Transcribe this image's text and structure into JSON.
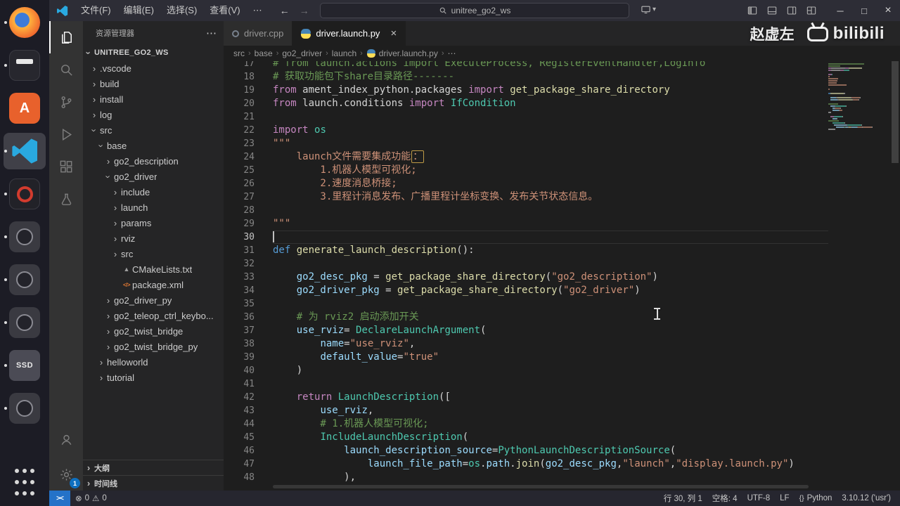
{
  "colors": {
    "editor_bg": "#1e1e1e",
    "sidebar_bg": "#252526",
    "activitybar_bg": "#333333",
    "titlebar_bg": "#2d2d36",
    "statusbar_bg": "#26262f",
    "remote_blue": "#2472c8",
    "badge_blue": "#0e70c0",
    "dock_bg": "#1c1c25"
  },
  "token_colors": {
    "c": "#6a9955",
    "k": "#c586c0",
    "kd": "#569cd6",
    "f": "#dcdcaa",
    "s": "#ce9178",
    "sbox": "#ce9178",
    "v": "#9cdcfe",
    "t": "#4ec9b0",
    "p": "#bdbdbd"
  },
  "icons": {
    "chevron": "›",
    "more": "⋯",
    "back": "←",
    "forward": "→",
    "cast_chevron": "▾",
    "window_minimize": "─",
    "window_maximize": "□",
    "window_close": "×",
    "error": "⊗",
    "warning": "⚠",
    "braces": "{}",
    "remote": "><",
    "close": "×"
  },
  "titlebar": {
    "menus": [
      {
        "id": "file",
        "label": "文件(F)"
      },
      {
        "id": "edit",
        "label": "编辑(E)"
      },
      {
        "id": "selection",
        "label": "选择(S)"
      },
      {
        "id": "view",
        "label": "查看(V)"
      },
      {
        "id": "more",
        "label": "⋯"
      }
    ],
    "search_placeholder": "unitree_go2_ws"
  },
  "watermark": {
    "author": "赵虚左",
    "brand": "bilibili"
  },
  "activitybar": {
    "badge": "1"
  },
  "dock": {
    "items": [
      {
        "name": "firefox",
        "kind": "firefox",
        "running": true
      },
      {
        "name": "files-app",
        "kind": "darkapp",
        "running": true
      },
      {
        "name": "app-store",
        "kind": "store",
        "label": "A",
        "running": false
      },
      {
        "name": "vscode",
        "kind": "vscode",
        "running": true,
        "active": true
      },
      {
        "name": "screen-recorder",
        "kind": "recorder",
        "running": true
      },
      {
        "name": "camera-1",
        "kind": "cam",
        "running": true
      },
      {
        "name": "camera-2",
        "kind": "cam",
        "running": true
      },
      {
        "name": "camera-3",
        "kind": "cam",
        "running": true
      },
      {
        "name": "ssd-drive",
        "kind": "ssd",
        "label": "SSD",
        "running": true
      },
      {
        "name": "camera-4",
        "kind": "cam",
        "running": true
      },
      {
        "name": "show-apps",
        "kind": "grid",
        "running": false
      }
    ]
  },
  "sidebar": {
    "title": "资源管理器",
    "section_label": "UNITREE_GO2_WS",
    "tree": [
      {
        "label": ".vscode",
        "indent": 0,
        "chevron": "right"
      },
      {
        "label": "build",
        "indent": 0,
        "chevron": "right"
      },
      {
        "label": "install",
        "indent": 0,
        "chevron": "right"
      },
      {
        "label": "log",
        "indent": 0,
        "chevron": "right"
      },
      {
        "label": "src",
        "indent": 0,
        "chevron": "down"
      },
      {
        "label": "base",
        "indent": 1,
        "chevron": "down"
      },
      {
        "label": "go2_description",
        "indent": 2,
        "chevron": "right"
      },
      {
        "label": "go2_driver",
        "indent": 2,
        "chevron": "down"
      },
      {
        "label": "include",
        "indent": 3,
        "chevron": "right"
      },
      {
        "label": "launch",
        "indent": 3,
        "chevron": "right"
      },
      {
        "label": "params",
        "indent": 3,
        "chevron": "right"
      },
      {
        "label": "rviz",
        "indent": 3,
        "chevron": "right"
      },
      {
        "label": "src",
        "indent": 3,
        "chevron": "right"
      },
      {
        "label": "CMakeLists.txt",
        "indent": 3,
        "icon": "cmake"
      },
      {
        "label": "package.xml",
        "indent": 3,
        "icon": "xml"
      },
      {
        "label": "go2_driver_py",
        "indent": 2,
        "chevron": "right"
      },
      {
        "label": "go2_teleop_ctrl_keybo...",
        "indent": 2,
        "chevron": "right"
      },
      {
        "label": "go2_twist_bridge",
        "indent": 2,
        "chevron": "right"
      },
      {
        "label": "go2_twist_bridge_py",
        "indent": 2,
        "chevron": "right"
      },
      {
        "label": "helloworld",
        "indent": 1,
        "chevron": "right"
      },
      {
        "label": "tutorial",
        "indent": 1,
        "chevron": "right"
      }
    ],
    "bottom_sections": [
      {
        "id": "outline",
        "label": "大纲"
      },
      {
        "id": "timeline",
        "label": "时间线"
      }
    ]
  },
  "tabs": [
    {
      "id": "driver-cpp",
      "label": "driver.cpp",
      "icon": "cpp",
      "active": false
    },
    {
      "id": "driver-launch-py",
      "label": "driver.launch.py",
      "icon": "python",
      "active": true,
      "close": "×"
    }
  ],
  "breadcrumbs": [
    {
      "id": "src",
      "label": "src"
    },
    {
      "id": "base",
      "label": "base"
    },
    {
      "id": "go2_driver",
      "label": "go2_driver"
    },
    {
      "id": "launch",
      "label": "launch"
    },
    {
      "id": "driver-launch-py",
      "label": "driver.launch.py",
      "icon": "python"
    },
    {
      "id": "symbol-more",
      "label": "⋯"
    }
  ],
  "editor": {
    "lines": [
      {
        "n": 17,
        "seg": [
          [
            "c",
            "# from launch.actions import ExecuteProcess, RegisterEventHandler,LogInfo"
          ]
        ]
      },
      {
        "n": 18,
        "seg": [
          [
            "c",
            "# 获取功能包下share目录路径-------"
          ]
        ]
      },
      {
        "n": 19,
        "seg": [
          [
            "k",
            "from "
          ],
          [
            "p",
            "ament_index_python.packages "
          ],
          [
            "k",
            "import "
          ],
          [
            "f",
            "get_package_share_directory"
          ]
        ]
      },
      {
        "n": 20,
        "seg": [
          [
            "k",
            "from "
          ],
          [
            "p",
            "launch.conditions "
          ],
          [
            "k",
            "import "
          ],
          [
            "t",
            "IfCondition"
          ]
        ]
      },
      {
        "n": 21,
        "seg": []
      },
      {
        "n": 22,
        "seg": [
          [
            "k",
            "import "
          ],
          [
            "t",
            "os"
          ]
        ]
      },
      {
        "n": 23,
        "seg": [
          [
            "s",
            "\"\"\""
          ]
        ]
      },
      {
        "n": 24,
        "seg": [
          [
            "s",
            "    launch文件需要集成功能"
          ],
          [
            "sbox",
            "："
          ]
        ]
      },
      {
        "n": 25,
        "seg": [
          [
            "s",
            "        1.机器人模型可视化;"
          ]
        ]
      },
      {
        "n": 26,
        "seg": [
          [
            "s",
            "        2.速度消息桥接;"
          ]
        ]
      },
      {
        "n": 27,
        "seg": [
          [
            "s",
            "        3.里程计消息发布、广播里程计坐标变换、发布关节状态信息。"
          ]
        ]
      },
      {
        "n": 28,
        "seg": []
      },
      {
        "n": 29,
        "seg": [
          [
            "s",
            "\"\"\""
          ]
        ]
      },
      {
        "n": 30,
        "seg": [],
        "cur": true,
        "cursor": true
      },
      {
        "n": 31,
        "seg": [
          [
            "kd",
            "def "
          ],
          [
            "f",
            "generate_launch_description"
          ],
          [
            "p",
            "():"
          ]
        ]
      },
      {
        "n": 32,
        "seg": []
      },
      {
        "n": 33,
        "seg": [
          [
            "p",
            "    "
          ],
          [
            "v",
            "go2_desc_pkg"
          ],
          [
            "p",
            " = "
          ],
          [
            "f",
            "get_package_share_directory"
          ],
          [
            "p",
            "("
          ],
          [
            "s",
            "\"go2_description\""
          ],
          [
            "p",
            ")"
          ]
        ]
      },
      {
        "n": 34,
        "seg": [
          [
            "p",
            "    "
          ],
          [
            "v",
            "go2_driver_pkg"
          ],
          [
            "p",
            " = "
          ],
          [
            "f",
            "get_package_share_directory"
          ],
          [
            "p",
            "("
          ],
          [
            "s",
            "\"go2_driver\""
          ],
          [
            "p",
            ")"
          ]
        ]
      },
      {
        "n": 35,
        "seg": []
      },
      {
        "n": 36,
        "seg": [
          [
            "c",
            "    # 为 rviz2 启动添加开关"
          ]
        ]
      },
      {
        "n": 37,
        "seg": [
          [
            "p",
            "    "
          ],
          [
            "v",
            "use_rviz"
          ],
          [
            "p",
            "= "
          ],
          [
            "t",
            "DeclareLaunchArgument"
          ],
          [
            "p",
            "("
          ]
        ]
      },
      {
        "n": 38,
        "seg": [
          [
            "p",
            "        "
          ],
          [
            "v",
            "name"
          ],
          [
            "p",
            "="
          ],
          [
            "s",
            "\"use_rviz\""
          ],
          [
            "p",
            ","
          ]
        ]
      },
      {
        "n": 39,
        "seg": [
          [
            "p",
            "        "
          ],
          [
            "v",
            "default_value"
          ],
          [
            "p",
            "="
          ],
          [
            "s",
            "\"true\""
          ]
        ]
      },
      {
        "n": 40,
        "seg": [
          [
            "p",
            "    )"
          ]
        ]
      },
      {
        "n": 41,
        "seg": []
      },
      {
        "n": 42,
        "seg": [
          [
            "p",
            "    "
          ],
          [
            "k",
            "return "
          ],
          [
            "t",
            "LaunchDescription"
          ],
          [
            "p",
            "(["
          ]
        ]
      },
      {
        "n": 43,
        "seg": [
          [
            "p",
            "        "
          ],
          [
            "v",
            "use_rviz"
          ],
          [
            "p",
            ","
          ]
        ]
      },
      {
        "n": 44,
        "seg": [
          [
            "c",
            "        # 1.机器人模型可视化;"
          ]
        ]
      },
      {
        "n": 45,
        "seg": [
          [
            "p",
            "        "
          ],
          [
            "t",
            "IncludeLaunchDescription"
          ],
          [
            "p",
            "("
          ]
        ]
      },
      {
        "n": 46,
        "seg": [
          [
            "p",
            "            "
          ],
          [
            "v",
            "launch_description_source"
          ],
          [
            "p",
            "="
          ],
          [
            "t",
            "PythonLaunchDescriptionSource"
          ],
          [
            "p",
            "("
          ]
        ]
      },
      {
        "n": 47,
        "seg": [
          [
            "p",
            "                "
          ],
          [
            "v",
            "launch_file_path"
          ],
          [
            "p",
            "="
          ],
          [
            "t",
            "os"
          ],
          [
            "p",
            "."
          ],
          [
            "v",
            "path"
          ],
          [
            "p",
            "."
          ],
          [
            "f",
            "join"
          ],
          [
            "p",
            "("
          ],
          [
            "v",
            "go2_desc_pkg"
          ],
          [
            "p",
            ","
          ],
          [
            "s",
            "\"launch\""
          ],
          [
            "p",
            ","
          ],
          [
            "s",
            "\"display.launch.py\""
          ],
          [
            "p",
            ")"
          ]
        ]
      },
      {
        "n": 48,
        "seg": [
          [
            "p",
            "            ),"
          ]
        ]
      }
    ]
  },
  "statusbar": {
    "problems": {
      "errors": "0",
      "warnings": "0"
    },
    "right": [
      {
        "name": "cursor-position",
        "label": "行 30, 列 1"
      },
      {
        "name": "indentation",
        "label": "空格: 4"
      },
      {
        "name": "encoding",
        "label": "UTF-8"
      },
      {
        "name": "eol",
        "label": "LF"
      },
      {
        "name": "language-mode",
        "icon": "braces",
        "label": "Python"
      },
      {
        "name": "python-interpreter",
        "label": "3.10.12 ('usr')"
      }
    ]
  }
}
